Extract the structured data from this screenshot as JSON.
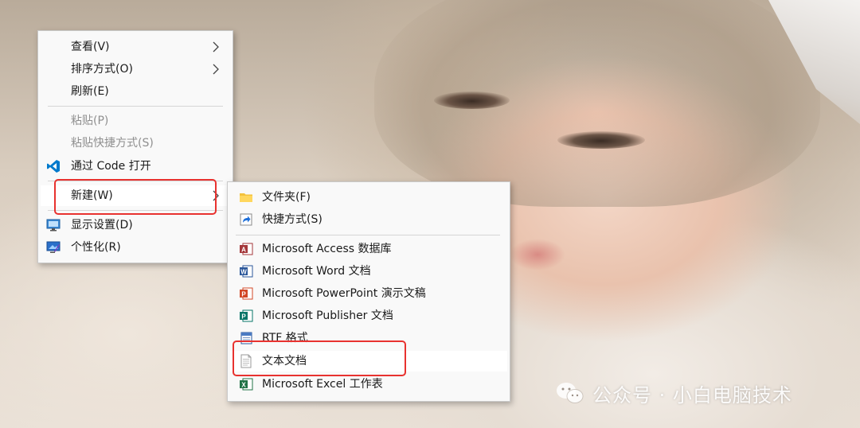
{
  "context_menu": {
    "items": [
      {
        "label": "查看(V)",
        "has_submenu": true,
        "enabled": true
      },
      {
        "label": "排序方式(O)",
        "has_submenu": true,
        "enabled": true
      },
      {
        "label": "刷新(E)",
        "enabled": true
      },
      {
        "label": "粘贴(P)",
        "enabled": false
      },
      {
        "label": "粘贴快捷方式(S)",
        "enabled": false
      },
      {
        "label": "通过 Code 打开",
        "icon": "vscode-icon",
        "enabled": true
      },
      {
        "label": "新建(W)",
        "has_submenu": true,
        "enabled": true,
        "highlighted": true
      },
      {
        "label": "显示设置(D)",
        "icon": "display-settings-icon",
        "enabled": true
      },
      {
        "label": "个性化(R)",
        "icon": "personalize-icon",
        "enabled": true
      }
    ]
  },
  "new_submenu": {
    "items": [
      {
        "label": "文件夹(F)",
        "icon": "folder-icon"
      },
      {
        "label": "快捷方式(S)",
        "icon": "shortcut-icon"
      },
      {
        "label": "Microsoft Access 数据库",
        "icon": "access-icon"
      },
      {
        "label": "Microsoft Word 文档",
        "icon": "word-icon"
      },
      {
        "label": "Microsoft PowerPoint 演示文稿",
        "icon": "powerpoint-icon"
      },
      {
        "label": "Microsoft Publisher 文档",
        "icon": "publisher-icon"
      },
      {
        "label": "RTF 格式",
        "icon": "rtf-icon"
      },
      {
        "label": "文本文档",
        "icon": "text-document-icon",
        "highlighted": true
      },
      {
        "label": "Microsoft Excel 工作表",
        "icon": "excel-icon"
      }
    ]
  },
  "watermark": {
    "text": "公众号 · 小白电脑技术"
  },
  "colors": {
    "annotation": "#e8322f",
    "menu_bg": "#f9f9f9",
    "access": "#a4373a",
    "word": "#2b579a",
    "powerpoint": "#d24726",
    "publisher": "#077568",
    "excel": "#217346",
    "vscode": "#007acc",
    "folder": "#f4c23c"
  }
}
